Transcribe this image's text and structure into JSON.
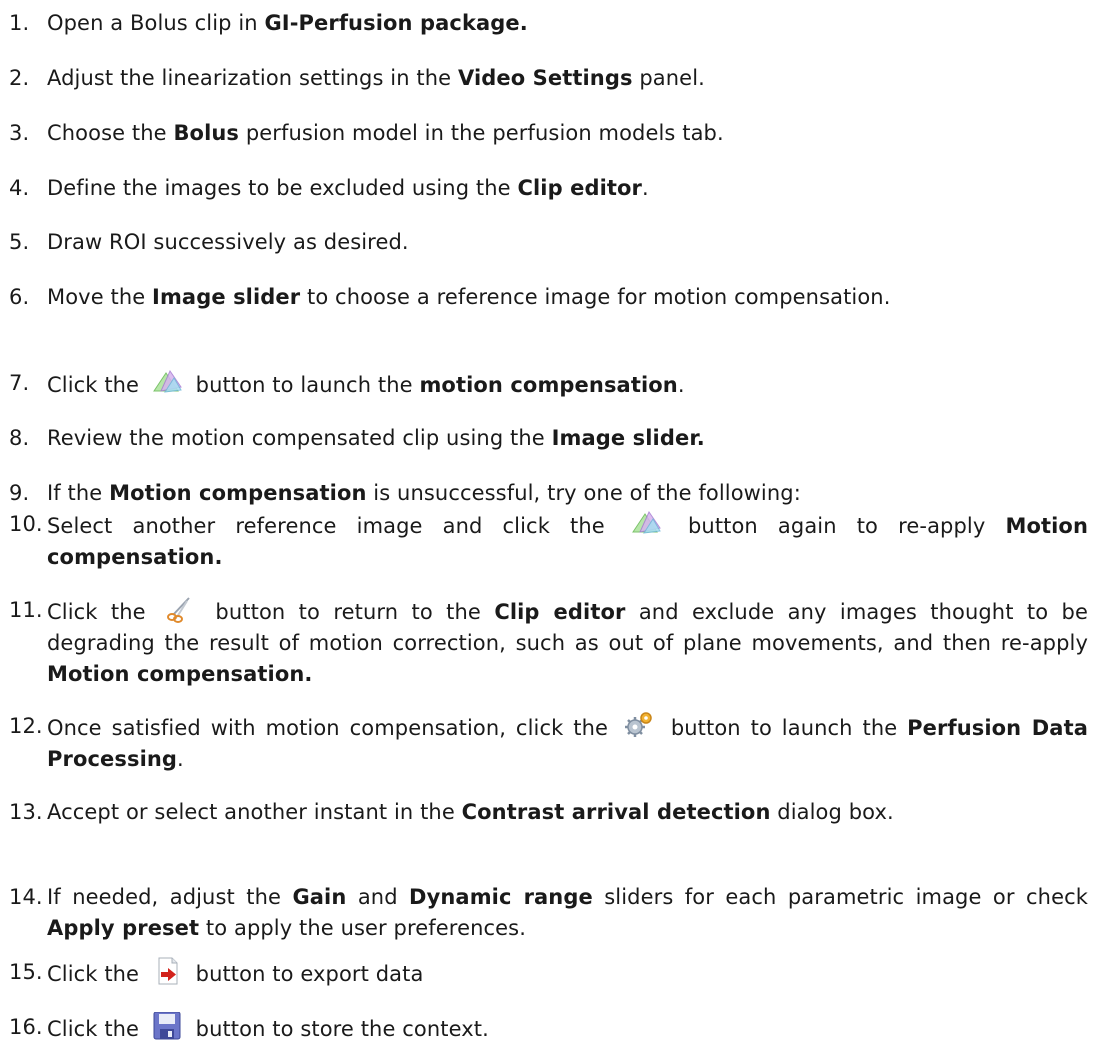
{
  "steps": [
    {
      "num": "1.",
      "parts": [
        {
          "t": "Open a Bolus clip in "
        },
        {
          "b": "GI-Perfusion package."
        }
      ]
    },
    {
      "num": "2.",
      "parts": [
        {
          "t": "Adjust the linearization settings in the "
        },
        {
          "b": "Video Settings"
        },
        {
          "t": " panel."
        }
      ]
    },
    {
      "num": "3.",
      "parts": [
        {
          "t": "Choose the "
        },
        {
          "b": "Bolus"
        },
        {
          "t": " perfusion model in the perfusion models tab."
        }
      ]
    },
    {
      "num": "4.",
      "parts": [
        {
          "t": "Define the images to be excluded using the "
        },
        {
          "b": "Clip editor"
        },
        {
          "t": "."
        }
      ]
    },
    {
      "num": "5.",
      "parts": [
        {
          "t": "Draw ROI successively as desired."
        }
      ]
    },
    {
      "num": "6.",
      "parts": [
        {
          "t": "Move the "
        },
        {
          "b": "Image slider"
        },
        {
          "t": " to choose a reference image for motion compensation."
        }
      ]
    },
    {
      "num": "7.",
      "parts": [
        {
          "t": "Click the "
        },
        {
          "icon": "motion-compensation-icon"
        },
        {
          "t": " button to launch the "
        },
        {
          "b": "motion compensation"
        },
        {
          "t": "."
        }
      ]
    },
    {
      "num": "8.",
      "parts": [
        {
          "t": "Review the motion compensated clip using the "
        },
        {
          "b": "Image slider."
        }
      ]
    },
    {
      "num": "9.",
      "parts": [
        {
          "t": "If the "
        },
        {
          "b": "Motion compensation"
        },
        {
          "t": " is unsuccessful, try one of the following:"
        }
      ]
    },
    {
      "num": "10.",
      "parts": [
        {
          "t": "Select another reference image and click the "
        },
        {
          "icon": "motion-compensation-icon"
        },
        {
          "t": " button again to re-apply "
        },
        {
          "b": "Motion compensation."
        }
      ]
    },
    {
      "num": "11.",
      "parts": [
        {
          "t": "Click the "
        },
        {
          "icon": "scissors-icon"
        },
        {
          "t": " button to return to the "
        },
        {
          "b": "Clip editor"
        },
        {
          "t": " and exclude any images thought to be degrading the result of motion correction, such as out of plane movements, and then re-apply "
        },
        {
          "b": "Motion compensation."
        }
      ]
    },
    {
      "num": "12.",
      "parts": [
        {
          "t": "Once satisfied with motion compensation, click the "
        },
        {
          "icon": "gears-icon"
        },
        {
          "t": " button to launch the "
        },
        {
          "b": "Perfusion Data Processing"
        },
        {
          "t": "."
        }
      ]
    },
    {
      "num": "13.",
      "parts": [
        {
          "t": "Accept or select another instant in the "
        },
        {
          "b": "Contrast arrival detection"
        },
        {
          "t": " dialog box."
        }
      ]
    },
    {
      "num": "14.",
      "parts": [
        {
          "t": "If needed, adjust the "
        },
        {
          "b": "Gain"
        },
        {
          "t": " and "
        },
        {
          "b": "Dynamic range"
        },
        {
          "t": " sliders for each parametric image or check "
        },
        {
          "b": "Apply preset"
        },
        {
          "t": " to apply the user preferences."
        }
      ]
    },
    {
      "num": "15.",
      "parts": [
        {
          "t": "Click the "
        },
        {
          "icon": "export-icon"
        },
        {
          "t": " button to export data"
        }
      ]
    },
    {
      "num": "16.",
      "parts": [
        {
          "t": "Click the "
        },
        {
          "icon": "save-icon"
        },
        {
          "t": " button to store the context."
        }
      ]
    }
  ]
}
